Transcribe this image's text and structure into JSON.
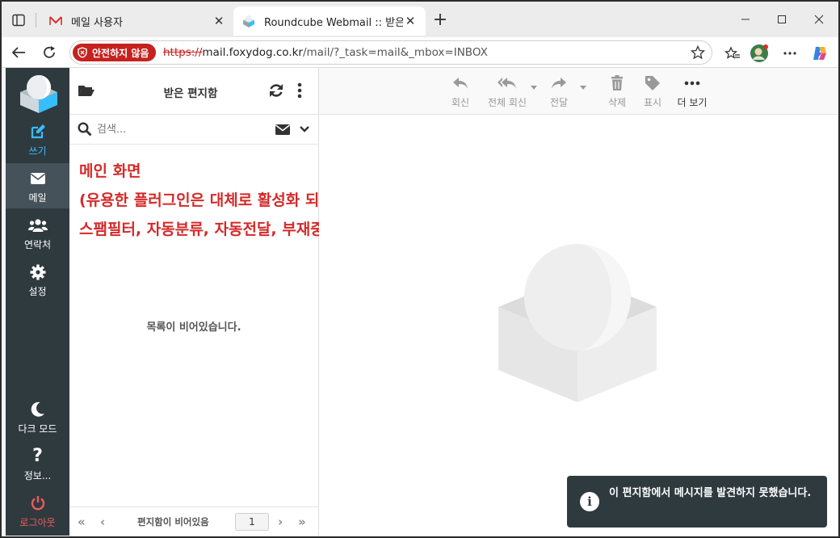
{
  "browser": {
    "tabs": [
      {
        "title": "메일 사용자"
      },
      {
        "title": "Roundcube Webmail :: 받은 편지함"
      }
    ],
    "security_label": "안전하지 않음",
    "url_scheme": "https://",
    "url_host": "mail.foxydog.co.kr",
    "url_path": "/mail/?_task=mail&_mbox=INBOX"
  },
  "sidebar": {
    "compose": "쓰기",
    "mail": "메일",
    "contacts": "연락처",
    "settings": "설정",
    "darkmode": "다크 모드",
    "about": "정보...",
    "logout": "로그아웃"
  },
  "list": {
    "title": "받은 편지함",
    "search_placeholder": "검색...",
    "empty": "목록이 비어있습니다.",
    "pager_text": "편지함이 비어있음",
    "page": "1"
  },
  "toolbar": {
    "reply": "회신",
    "reply_all": "전체 회신",
    "forward": "전달",
    "delete": "삭제",
    "mark": "표시",
    "more": "더 보기"
  },
  "overlay": {
    "line1": "메인 화면",
    "line2": "(유용한 플러그인은 대체로 활성화 되어 있음)",
    "line3": "스팸필터, 자동분류, 자동전달, 부재중 응답, 사용자 비밀번호 변경 등"
  },
  "toast": {
    "message": "이 편지함에서 메시지를 발견하지 못했습니다."
  },
  "colors": {
    "sidebar_bg": "#2f3a3f",
    "accent": "#37beff",
    "overlay_text": "#d42a2a",
    "insecure_badge": "#c5221f"
  }
}
